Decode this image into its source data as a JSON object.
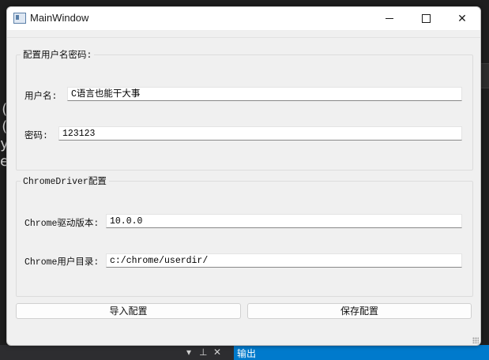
{
  "window": {
    "title": "MainWindow",
    "controls": {
      "minimize": "minimize",
      "maximize": "maximize",
      "close": "close"
    }
  },
  "credentials_group": {
    "title": "配置用户名密码:",
    "username_label": "用户名:",
    "username_value": "C语言也能干大事",
    "password_label": "密码:",
    "password_value": "123123"
  },
  "chromedriver_group": {
    "title": "ChromeDriver配置",
    "version_label": "Chrome驱动版本:",
    "version_value": "10.0.0",
    "userdir_label": "Chrome用户目录:",
    "userdir_value": "c:/chrome/userdir/"
  },
  "buttons": {
    "import_label": "导入配置",
    "save_label": "保存配置"
  },
  "background": {
    "output_tab": "输出",
    "left_glyphs": [
      "(",
      "(",
      "y",
      "e"
    ]
  },
  "colors": {
    "window_bg": "#f0f0f0",
    "titlebar_bg": "#ffffff",
    "editor_bg": "#1e1e1e",
    "output_tab_bg": "#007acc"
  }
}
